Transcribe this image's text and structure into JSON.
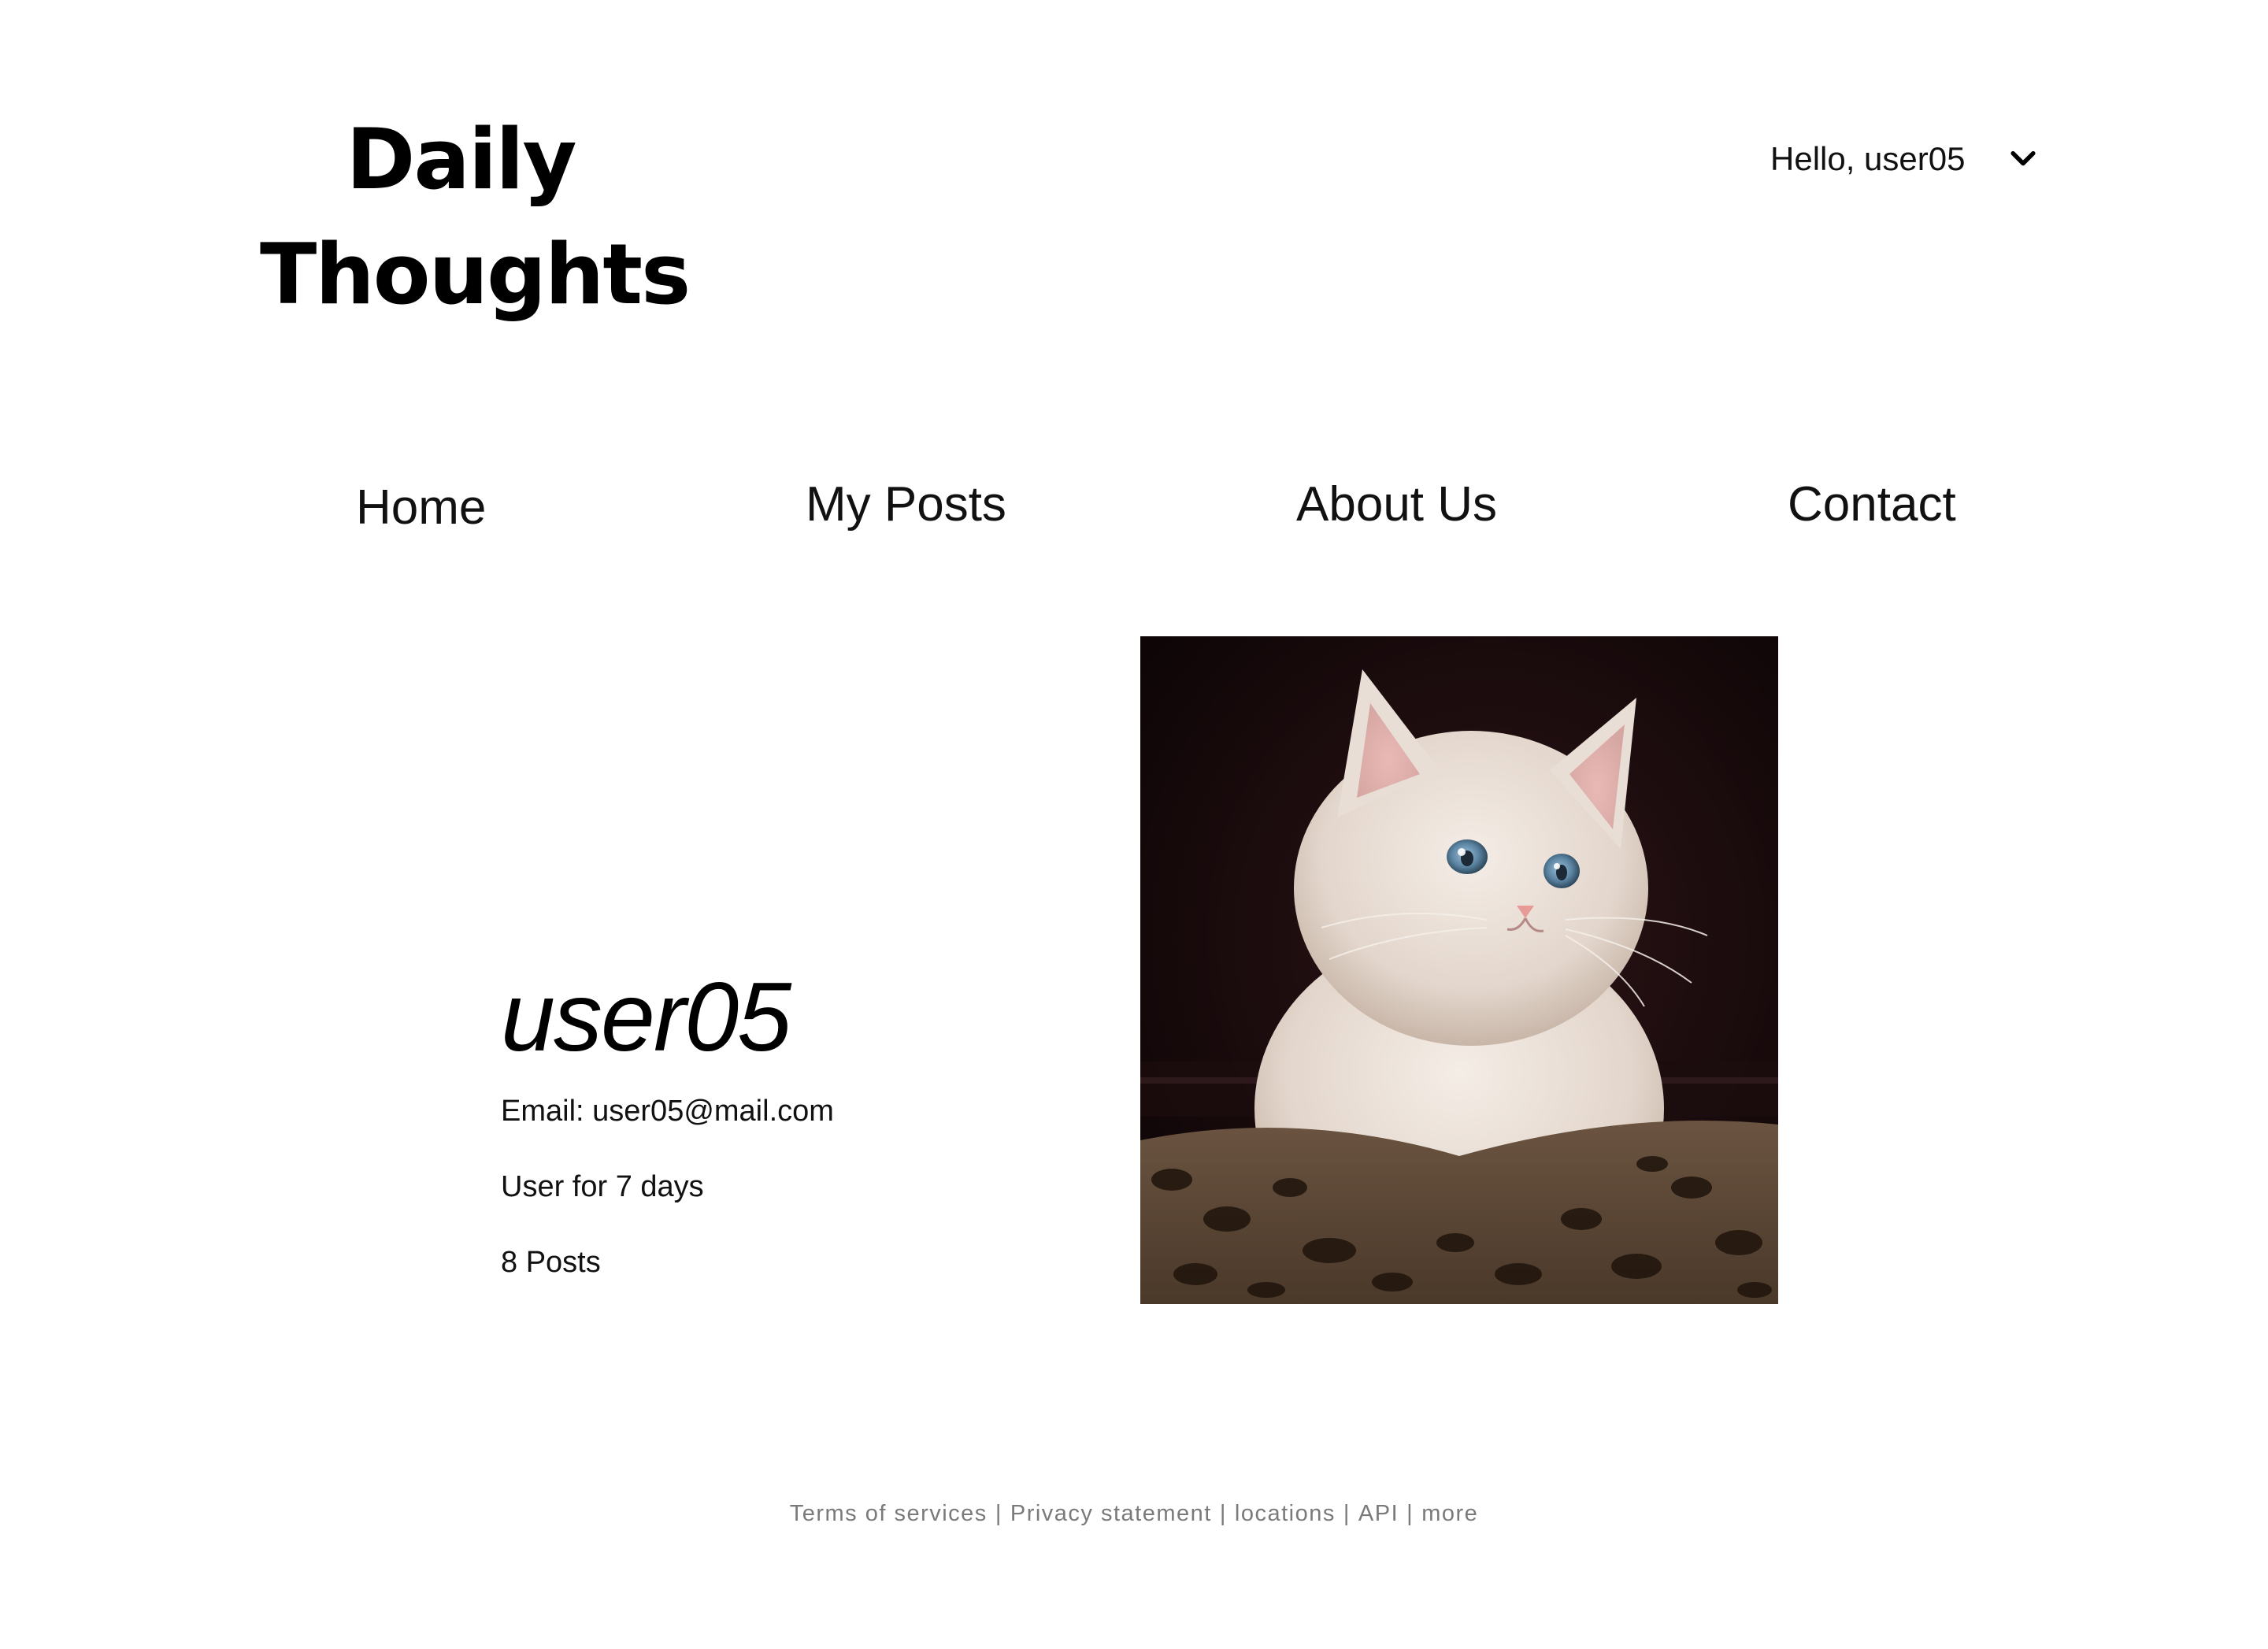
{
  "header": {
    "logo_line1": "Daily",
    "logo_line2": "Thoughts",
    "greeting": "Hello, user05",
    "menu_icon": "chevron-down-icon"
  },
  "nav": {
    "items": [
      {
        "label": "Home"
      },
      {
        "label": "My Posts"
      },
      {
        "label": "About Us"
      },
      {
        "label": "Contact"
      }
    ]
  },
  "profile": {
    "username": "user05",
    "email": "Email: user05@mail.com",
    "member_since": "User for 7 days",
    "post_count": "8 Posts",
    "avatar": "kitten-photo"
  },
  "footer": {
    "links": [
      "Terms of services",
      "Privacy statement",
      "locations",
      "API",
      "more"
    ],
    "separator": "|"
  },
  "colors": {
    "text": "#000000",
    "footer_text": "#7a7a7a",
    "background": "#ffffff"
  }
}
